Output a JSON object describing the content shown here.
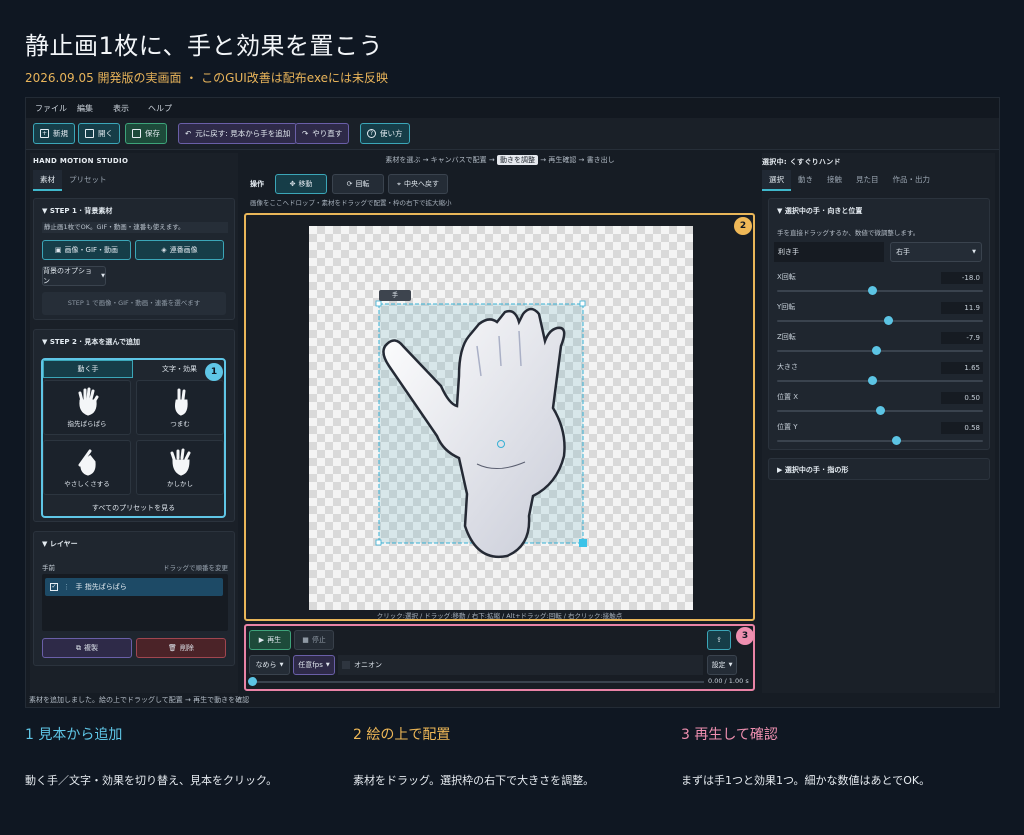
{
  "page": {
    "title": "静止画1枚に、手と効果を置こう",
    "subtitle": "2026.09.05 開発版の実画面 ・ このGUI改善は配布exeには未反映"
  },
  "menu": [
    "ファイル",
    "編集",
    "表示",
    "ヘルプ"
  ],
  "toolbar": {
    "new": "新規",
    "open": "開く",
    "save": "保存",
    "undo": "元に戻す: 見本から手を追加",
    "redo": "やり直す",
    "help": "使い方"
  },
  "left": {
    "app_name": "HAND MOTION STUDIO",
    "tabs": [
      "素材",
      "プリセット"
    ],
    "step1": {
      "head": "STEP 1 · 背景素材",
      "hint": "静止画1枚でOK。GIF・動画・連番も使えます。",
      "btn_media": "画像・GIF・動画",
      "btn_seq": "連番画像",
      "btn_options": "背景のオプション",
      "placeholder": "STEP 1 で画像・GIF・動画・連番を選べます"
    },
    "step2": {
      "head": "STEP 2 · 見本を選んで追加",
      "tabs": [
        "動く手",
        "文字・効果"
      ],
      "presets": [
        "指先ぱらぱら",
        "つまむ",
        "やさしくさする",
        "かしかし"
      ],
      "all": "すべてのプリセットを見る"
    },
    "layers": {
      "head": "レイヤー",
      "front": "手前",
      "hint": "ドラッグで順番を変更",
      "item": "手  指先ぱらぱら",
      "duplicate": "複製",
      "delete": "削除"
    }
  },
  "center": {
    "breadcrumb_steps": [
      "素材を選ぶ",
      "キャンバスで配置",
      "動きを調整",
      "再生確認",
      "書き出し"
    ],
    "breadcrumb_active": 2,
    "ops_label": "操作",
    "ops": [
      "移動",
      "回転",
      "中央へ戻す"
    ],
    "hint": "画像をここへドロップ・素材をドラッグで配置・枠の右下で拡大縮小",
    "handle_label": "手",
    "canvas_help": "クリック:選択 / ドラッグ:移動 / 右下:拡縮 / Alt+ドラッグ:回転 / 右クリック:接触点",
    "play": "再生",
    "stop": "停止",
    "easing": "なめら",
    "fps": "任意fps",
    "onion": "オニオン",
    "settings": "設定",
    "time": "0.00 / 1.00 s",
    "progress": 0
  },
  "right": {
    "selected": "選択中: くすぐりハンド",
    "tabs": [
      "選択",
      "動き",
      "接触",
      "見た目",
      "作品・出力"
    ],
    "section_head": "選択中の手 · 向きと位置",
    "section_hint": "手を直接ドラッグするか、数値で微調整します。",
    "hand_label": "利き手",
    "hand_value": "右手",
    "sliders": [
      {
        "label": "X回転",
        "value": "-18.0",
        "pos": 0.46
      },
      {
        "label": "Y回転",
        "value": "11.9",
        "pos": 0.54
      },
      {
        "label": "Z回転",
        "value": "-7.9",
        "pos": 0.48
      },
      {
        "label": "大きさ",
        "value": "1.65",
        "pos": 0.46
      },
      {
        "label": "位置 X",
        "value": "0.50",
        "pos": 0.5
      },
      {
        "label": "位置 Y",
        "value": "0.58",
        "pos": 0.58
      }
    ],
    "collapsed_head": "選択中の手 · 指の形"
  },
  "status": "素材を追加しました。絵の上でドラッグして配置 → 再生で動きを確認",
  "badges": [
    "1",
    "2",
    "3"
  ],
  "steps": [
    {
      "head": "1  見本から追加",
      "desc": "動く手／文字・効果を切り替え、見本をクリック。",
      "color": "#5fc6e6"
    },
    {
      "head": "2  絵の上で配置",
      "desc": "素材をドラッグ。選択枠の右下で大きさを調整。",
      "color": "#efb857"
    },
    {
      "head": "3  再生して確認",
      "desc": "まずは手1つと効果1つ。細かな数値はあとでOK。",
      "color": "#ee8fb0"
    }
  ],
  "colors": {
    "accent_teal": "#40b8cc",
    "badge1": "#5fc6e6",
    "badge2": "#efb857",
    "badge3": "#ee8fb0"
  }
}
